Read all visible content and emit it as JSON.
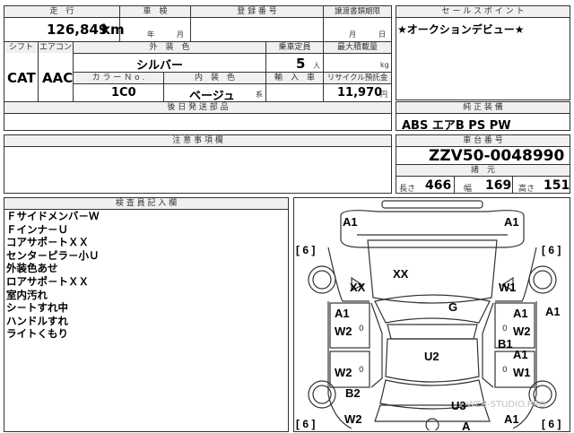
{
  "sheet": {
    "mileage_label": "走　行",
    "mileage_value": "126,849",
    "mileage_unit": "km",
    "shaken_label": "車　検",
    "shaken_year": "年",
    "shaken_month": "月",
    "reg_label": "登 録 番 号",
    "transfer_label": "譲渡書類期限",
    "transfer_month": "月",
    "transfer_day": "日",
    "shift_label": "シフト",
    "shift_value": "CAT",
    "ac_label": "エアコン",
    "ac_value": "AAC",
    "exterior_label": "外　装　色",
    "exterior_value": "シルバー",
    "capacity_label": "乗車定員",
    "capacity_value": "5",
    "capacity_unit": "人",
    "maxload_label": "最大積載量",
    "maxload_unit": "kg",
    "colorno_label": "カ ラ ー Ｎ o .",
    "colorno_value": "1C0",
    "interior_label": "内　装　色",
    "interior_value": "ベージュ",
    "interior_suffix": "系",
    "import_label": "輸　入　車",
    "recycle_label": "リサイクル預託金",
    "recycle_value": "11,970",
    "recycle_unit": "円",
    "later_docs_label": "後 日 発 送 部 品",
    "sales_label": "セ ー ル ス ポ イ ン ト",
    "sales_text": "★オークションデビュー★",
    "equip_label": "純 正 装 備",
    "equip_value": "ABS エアB PS PW",
    "caution_label": "注 意 事 項 欄",
    "chassis_label": "車 台 番 号",
    "chassis_value": "ZZV50-0048990",
    "dims_label": "諸　元",
    "length_label": "長さ",
    "length_value": "466",
    "width_label": "幅",
    "width_value": "169",
    "height_label": "高さ",
    "height_value": "151",
    "inspector_label": "検 査 員 記 入 欄"
  },
  "inspector_notes": [
    "Ｆサイドメンバ－Ｗ",
    "Ｆインナ－Ｕ",
    "コアサポ－トＸＸ",
    "センタ－ピラ－小Ｕ",
    "外装色あせ",
    "ロアサポ－トＸＸ",
    "室内汚れ",
    "シ－トすれ中",
    "ハンドルすれ",
    "ライトくもり"
  ],
  "diagram": {
    "tire_marks": [
      "[",
      "6",
      "]"
    ],
    "tire_labels": [
      "6",
      "6",
      "6",
      "6"
    ],
    "marks": {
      "front_left": "A1",
      "front_right": "A1",
      "hood": "XX",
      "fl_fender": "XX",
      "fr_fender": "W1",
      "right_a": "A1",
      "roof": "G",
      "l_door1_a": "A1",
      "l_door1_w": "W2",
      "r_door1_a": "A1",
      "r_door1_w": "W2",
      "r_pillar": "B1",
      "trunk_lid": "U2",
      "l_door2_w": "W2",
      "r_door2_a": "A1",
      "r_door2_w": "W1",
      "l_rear": "B2",
      "r_rear_u": "U3",
      "l_bottom_w": "W2",
      "rear_a": "A",
      "rear_right_a": "A1"
    },
    "zero": "0",
    "watermark": "WEB-STUDIO.PRO"
  }
}
